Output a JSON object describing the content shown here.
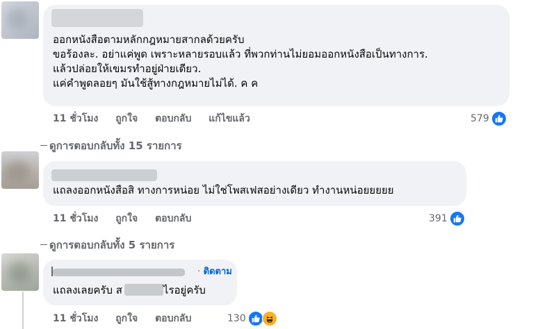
{
  "colors": {
    "bubble": "#f0f2f5",
    "meta": "#65676b",
    "link": "#0064d1",
    "like": "#1877f2",
    "haha": "#f7b125"
  },
  "comments": [
    {
      "lines": [
        "ออกหนังสือตามหลักกฎหมายสากลด้วยครับ",
        "ขอร้องละ. อย่าแค่พูด เพราะหลายรอบแล้ว ที่พวกท่านไม่ยอมออกหนังสือเป็นทางการ.",
        "แล้วปล่อยให้เขมรทำอยู่ฝ่ายเดียว.",
        "แค่คำพูดลอยๆ มันใช้สู้ทางกฎหมายไม่ได้. ค ค"
      ],
      "time": "11 ชั่วโมง",
      "like_label": "ถูกใจ",
      "reply_label": "ตอบกลับ",
      "edited_label": "แก้ไขแล้ว",
      "reaction_count": "579",
      "reactions": [
        "like-icon"
      ],
      "view_replies": "ดูการตอบกลับทั้ง 15 รายการ"
    },
    {
      "lines": [
        "แถลงออกหนังสือสิ ทางการหน่อย ไม่ใช่โพสเฟสอย่างเดียว ทำงานหน่อยยยยย"
      ],
      "time": "11 ชั่วโมง",
      "like_label": "ถูกใจ",
      "reply_label": "ตอบกลับ",
      "reaction_count": "391",
      "reactions": [
        "like-icon"
      ],
      "view_replies": "ดูการตอบกลับทั้ง 5 รายการ"
    },
    {
      "follow_label": "ติดตาม",
      "text_before": "แถลงเลยครับ ส",
      "text_after": "ไรอยู่ครับ",
      "time": "11 ชั่วโมง",
      "like_label": "ถูกใจ",
      "reply_label": "ตอบกลับ",
      "reaction_count": "130",
      "reactions": [
        "like-icon",
        "haha-icon"
      ]
    }
  ]
}
